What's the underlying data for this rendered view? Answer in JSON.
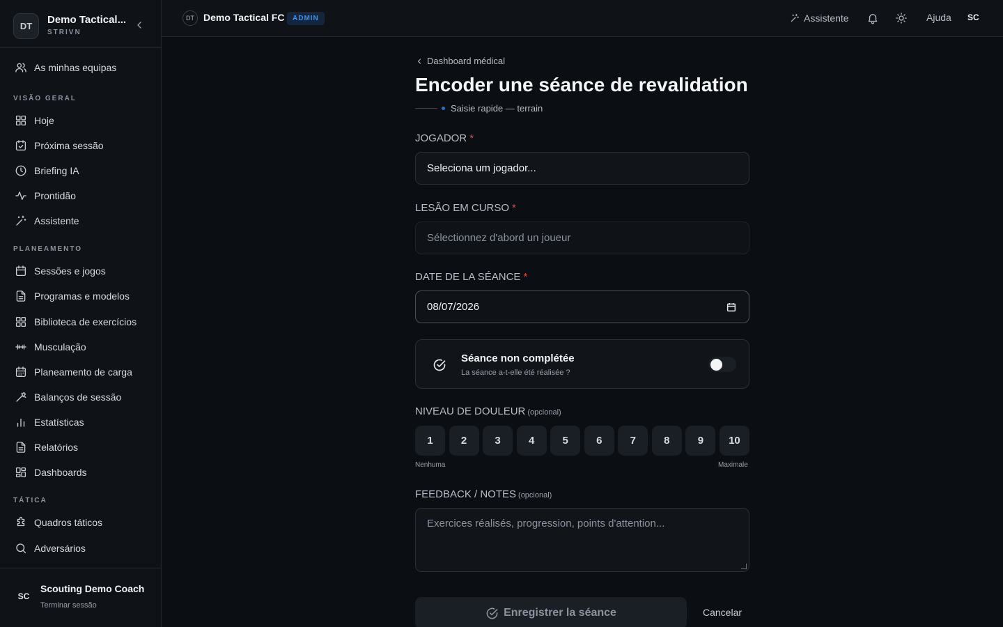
{
  "workspace": {
    "initials": "DT",
    "name": "Demo Tactical...",
    "sub": "STRIVN"
  },
  "sidebar": {
    "my_teams": "As minhas equipas",
    "sections": {
      "overview": "VISÃO GERAL",
      "planning": "PLANEAMENTO",
      "tactics": "TÁTICA"
    },
    "overview_items": [
      "Hoje",
      "Próxima sessão",
      "Briefing IA",
      "Prontidão",
      "Assistente"
    ],
    "planning_items": [
      "Sessões e jogos",
      "Programas e modelos",
      "Biblioteca de exercícios",
      "Musculação",
      "Planeamento de carga",
      "Balanços de sessão",
      "Estatísticas",
      "Relatórios",
      "Dashboards"
    ],
    "tactics_items": [
      "Quadros táticos",
      "Adversários"
    ]
  },
  "user": {
    "initials": "SC",
    "name": "Scouting Demo Coach",
    "logout": "Terminar sessão"
  },
  "topbar": {
    "team_initials": "DT",
    "team_name": "Demo Tactical FC",
    "badge": "ADMIN",
    "assistant": "Assistente",
    "help": "Ajuda",
    "user_initials": "SC"
  },
  "page": {
    "back": "Dashboard médical",
    "title": "Encoder une séance de revalidation",
    "subtitle": "Saisie rapide — terrain"
  },
  "form": {
    "player_label": "JOGADOR",
    "player_value": "Seleciona um jogador...",
    "injury_label": "LESÃO EM CURSO",
    "injury_placeholder": "Sélectionnez d'abord un joueur",
    "date_label": "DATE DE LA SÉANCE",
    "date_value": "08/07/2026",
    "required_mark": "*",
    "incomplete_title": "Séance non complétée",
    "incomplete_sub": "La séance a-t-elle été réalisée ?",
    "incomplete_on": false,
    "pain_label": "NIVEAU DE DOULEUR",
    "optional": "(opcional)",
    "pain_levels": [
      "1",
      "2",
      "3",
      "4",
      "5",
      "6",
      "7",
      "8",
      "9",
      "10"
    ],
    "pain_min": "Nenhuma",
    "pain_max": "Maximale",
    "notes_label": "FEEDBACK / NOTES",
    "notes_placeholder": "Exercices réalisés, progression, points d'attention...",
    "save": "Enregistrer la séance",
    "cancel": "Cancelar"
  },
  "colors": {
    "accent": "#3d8fe8",
    "required": "#ef4444",
    "background": "#0b0e12"
  }
}
